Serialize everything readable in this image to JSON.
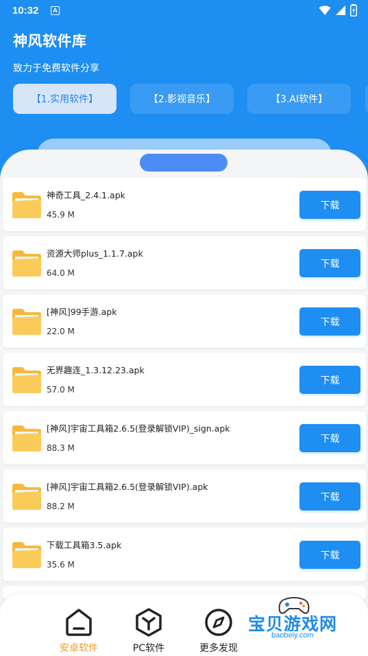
{
  "status_bar": {
    "time": "10:32",
    "a_badge": "A"
  },
  "header": {
    "title": "神风软件库",
    "subtitle": "致力于免费软件分享"
  },
  "tabs": [
    {
      "label": "【1.实用软件】",
      "active": true
    },
    {
      "label": "【2.影视音乐】",
      "active": false
    },
    {
      "label": "【3.AI软件】",
      "active": false
    }
  ],
  "files": [
    {
      "name": "神奇工具_2.4.1.apk",
      "size": "45.9 M",
      "button": "下载"
    },
    {
      "name": "资源大师plus_1.1.7.apk",
      "size": "64.0 M",
      "button": "下载"
    },
    {
      "name": "[神风]99手游.apk",
      "size": "22.0 M",
      "button": "下载"
    },
    {
      "name": "无界趣连_1.3.12.23.apk",
      "size": "57.0 M",
      "button": "下载"
    },
    {
      "name": "[神风]宇宙工具箱2.6.5(登录解锁VIP)_sign.apk",
      "size": "88.3 M",
      "button": "下载"
    },
    {
      "name": "[神风]宇宙工具箱2.6.5(登录解锁VIP).apk",
      "size": "88.2 M",
      "button": "下载"
    },
    {
      "name": "下载工具箱3.5.apk",
      "size": "35.6 M",
      "button": "下载"
    }
  ],
  "bottom_nav": [
    {
      "label": "安卓软件",
      "icon": "android-home-icon",
      "active": true
    },
    {
      "label": "PC软件",
      "icon": "cube-icon",
      "active": false
    },
    {
      "label": "更多发现",
      "icon": "compass-icon",
      "active": false
    }
  ],
  "watermark": {
    "text": "宝贝游戏网",
    "url": "baobeiy.com"
  },
  "colors": {
    "primary": "#1E8EF2",
    "active_nav": "#F39A1E",
    "folder": "#FBCB5A"
  }
}
